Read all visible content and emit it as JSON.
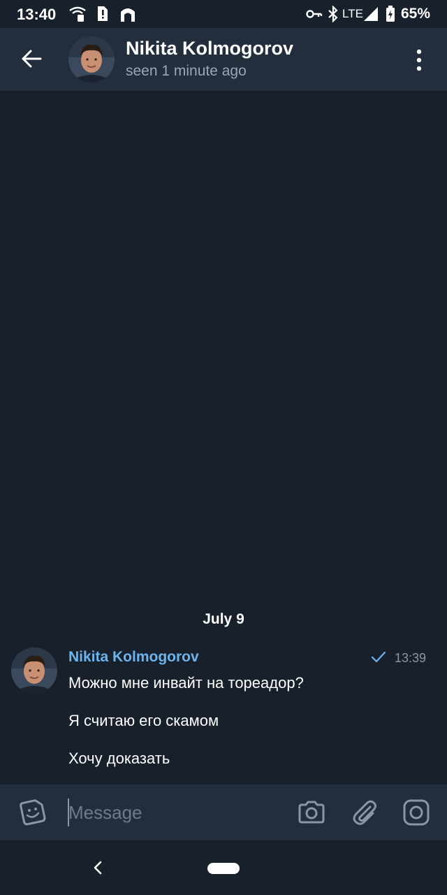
{
  "status_bar": {
    "time": "13:40",
    "network": "LTE",
    "battery": "65%",
    "icons": [
      "wifi-call-icon",
      "sim-alert-icon",
      "vpn-icon",
      "key-icon",
      "bluetooth-icon",
      "signal-icon",
      "battery-icon"
    ]
  },
  "header": {
    "name": "Nikita Kolmogorov",
    "status": "seen 1 minute ago",
    "icons": [
      "back-arrow-icon",
      "more-vertical-icon"
    ]
  },
  "chat": {
    "date_separator": "July 9",
    "message": {
      "sender": "Nikita Kolmogorov",
      "time": "13:39",
      "read_status": "sent",
      "lines": [
        "Можно мне инвайт на тореадор?",
        "Я считаю его скамом",
        "Хочу доказать"
      ]
    }
  },
  "input": {
    "placeholder": "Message",
    "value": "",
    "icons": [
      "sticker-icon",
      "camera-icon",
      "attach-icon",
      "instagram-icon"
    ]
  },
  "colors": {
    "background": "#18202b",
    "header": "#232e3c",
    "accent_name": "#6db4ee",
    "secondary_text": "#9aa6b3"
  }
}
